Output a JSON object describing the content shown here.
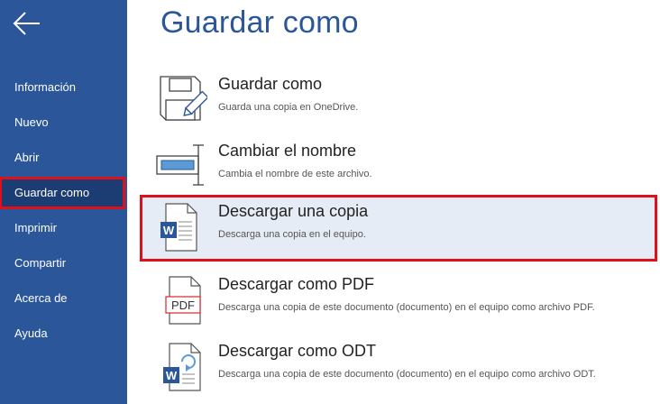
{
  "nav": {
    "back_icon": "back-arrow-icon",
    "items": [
      {
        "label": "Información"
      },
      {
        "label": "Nuevo"
      },
      {
        "label": "Abrir"
      },
      {
        "label": "Guardar como",
        "active": true
      },
      {
        "label": "Imprimir"
      },
      {
        "label": "Compartir"
      },
      {
        "label": "Acerca de"
      },
      {
        "label": "Ayuda"
      }
    ]
  },
  "main": {
    "title": "Guardar como",
    "options": [
      {
        "title": "Guardar como",
        "desc": "Guarda una copia en OneDrive.",
        "icon": "save-disk-pencil-icon"
      },
      {
        "title": "Cambiar el nombre",
        "desc": "Cambia el nombre de este archivo.",
        "icon": "rename-textbox-icon"
      },
      {
        "title": "Descargar una copia",
        "desc": "Descarga una copia en el equipo.",
        "icon": "word-document-icon",
        "selected": true
      },
      {
        "title": "Descargar como PDF",
        "desc": "Descarga una copia de este documento (documento) en el equipo como archivo PDF.",
        "icon": "pdf-document-icon",
        "icon_text": "PDF"
      },
      {
        "title": "Descargar como ODT",
        "desc": "Descarga una copia de este documento (documento) en el equipo como archivo ODT.",
        "icon": "word-odt-document-icon"
      }
    ]
  },
  "colors": {
    "sidebar": "#2b579a",
    "accent": "#2b579a",
    "highlight_border": "#e0101a",
    "selected_bg": "#e6ecf5",
    "pdf_red": "#d9242b"
  }
}
